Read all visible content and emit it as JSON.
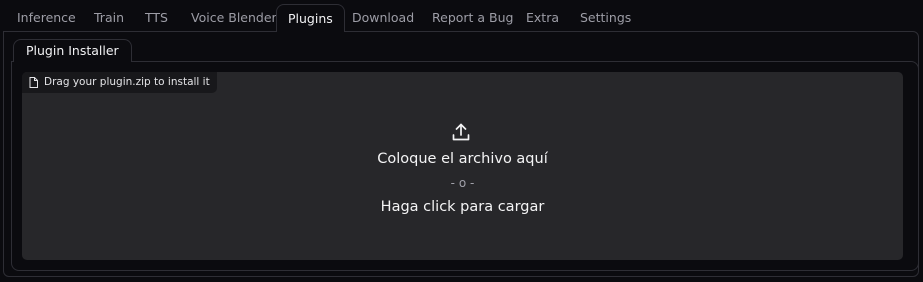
{
  "tabs": [
    {
      "label": "Inference"
    },
    {
      "label": "Train"
    },
    {
      "label": "TTS"
    },
    {
      "label": "Voice Blender"
    },
    {
      "label": "Plugins"
    },
    {
      "label": "Download"
    },
    {
      "label": "Report a Bug"
    },
    {
      "label": "Extra"
    },
    {
      "label": "Settings"
    }
  ],
  "active_tab": "Plugins",
  "subtab": {
    "label": "Plugin Installer"
  },
  "upload": {
    "label": "Drag your plugin.zip to install it",
    "label_icon": "file-icon",
    "icon": "upload-icon",
    "drop_text": "Coloque el archivo aquí",
    "separator": "- o -",
    "click_text": "Haga click para cargar"
  },
  "colors": {
    "background": "#0b0b0f",
    "dropzone": "#27272a",
    "border": "#2e2e35",
    "text": "#f2f2f4",
    "muted": "#9d9da6"
  }
}
